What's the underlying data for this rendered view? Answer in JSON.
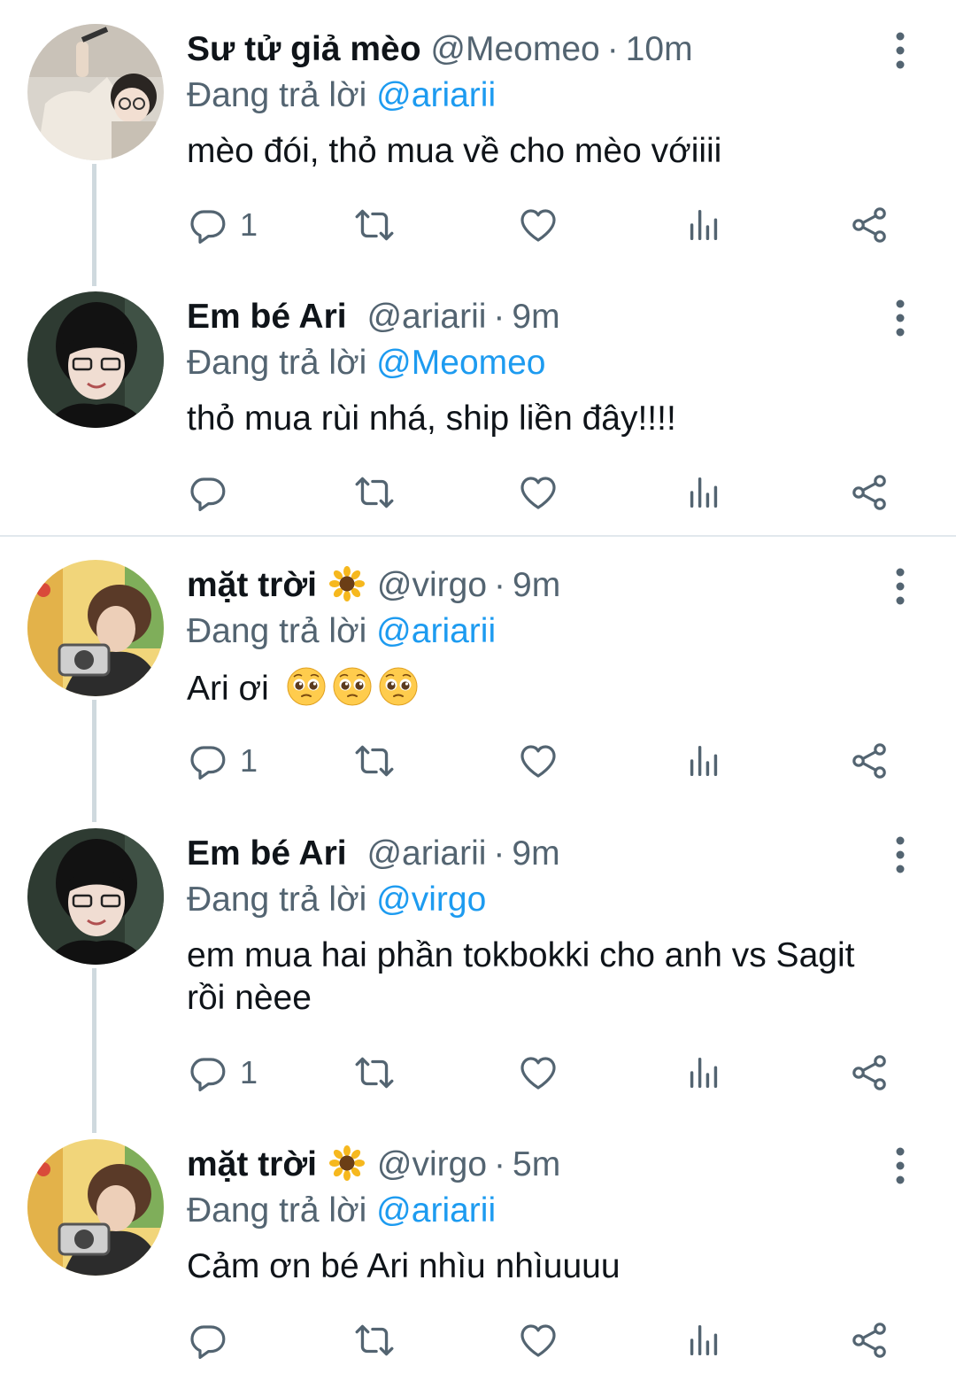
{
  "reply_prefix": "Đang trả lời",
  "tweets": [
    {
      "name": "Sư tử giả mèo",
      "handle": "@Meomeo",
      "time": "10m",
      "replying_to": "@ariarii",
      "text": "mèo đói, thỏ mua về cho mèo vớiiii",
      "reply_count": "1",
      "avatar": "user-photo-glasses-light"
    },
    {
      "name": "Em bé Ari",
      "handle": "@ariarii",
      "time": "9m",
      "replying_to": "@Meomeo",
      "text": "thỏ mua rùi nhá, ship liền đây!!!!",
      "reply_count": "",
      "avatar": "user-photo-glasses-dark"
    },
    {
      "name": "mặt trời",
      "name_emoji": "sunflower-icon",
      "handle": "@virgo",
      "time": "9m",
      "replying_to": "@ariarii",
      "text": "Ari ơi",
      "text_emoji": "pleading-face-icon ×3",
      "reply_count": "1",
      "avatar": "user-photo-camera"
    },
    {
      "name": "Em bé Ari",
      "handle": "@ariarii",
      "time": "9m",
      "replying_to": "@virgo",
      "text": "em mua hai phần tokbokki cho anh vs Sagit rồi nèee",
      "reply_count": "1",
      "avatar": "user-photo-glasses-dark"
    },
    {
      "name": "mặt trời",
      "name_emoji": "sunflower-icon",
      "handle": "@virgo",
      "time": "5m",
      "replying_to": "@ariarii",
      "text": "Cảm ơn bé Ari nhìu nhìuuuu",
      "reply_count": "",
      "avatar": "user-photo-camera"
    }
  ],
  "colors": {
    "text": "#0f1419",
    "secondary": "#536471",
    "link": "#1d9bf0",
    "thread_line": "#cfd9de"
  }
}
